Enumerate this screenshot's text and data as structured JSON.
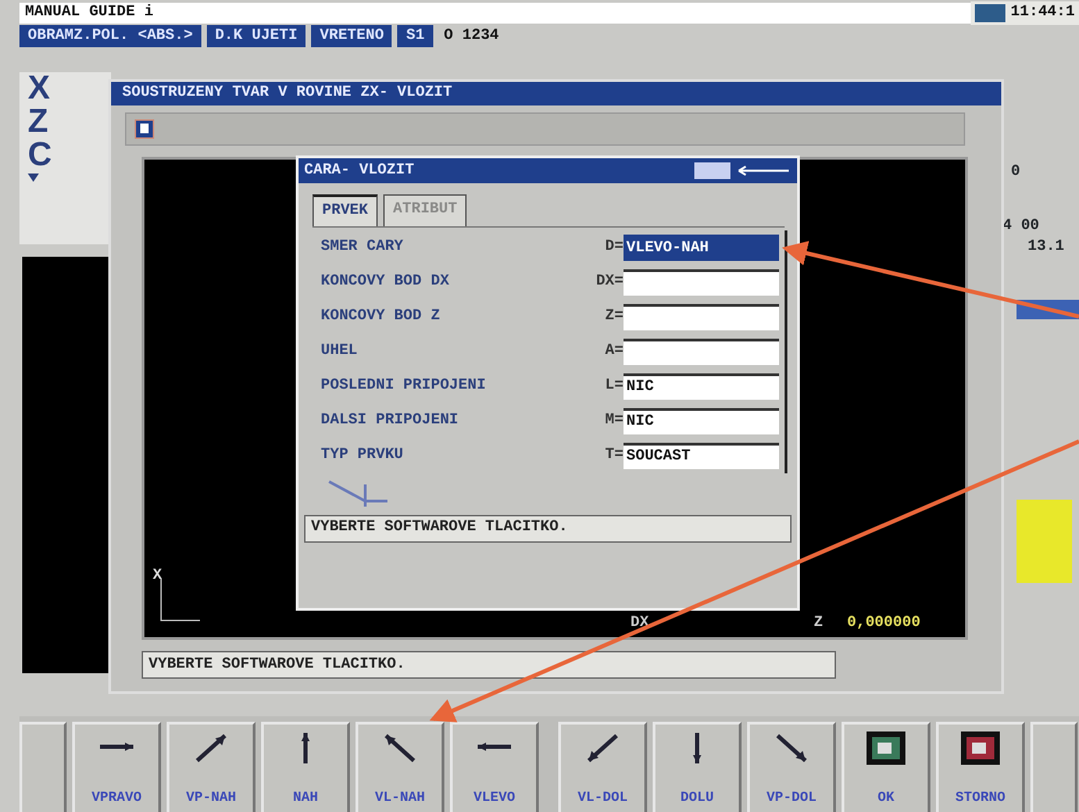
{
  "title_bar": {
    "title": "MANUAL GUIDE i",
    "clock": "11:44:1"
  },
  "status_row": {
    "segments": [
      "OBRAMZ.POL. <ABS.>",
      "D.K UJETI",
      "VRETENO",
      "S1"
    ],
    "program": "O 1234"
  },
  "axes": [
    "X",
    "Z",
    "C"
  ],
  "right_panel": {
    "texts": [
      "0",
      "4 00",
      "13.1"
    ]
  },
  "main_window": {
    "title": "SOUSTRUZENY TVAR V ROVINE ZX- VLOZIT",
    "canvas": {
      "axis_label": "X",
      "coord_label": "DX",
      "z_label": "Z",
      "z_value": "0,000000"
    },
    "message": "VYBERTE SOFTWAROVE TLACITKO."
  },
  "dialog": {
    "title": "CARA- VLOZIT",
    "tabs": [
      {
        "label": "PRVEK",
        "selected": true,
        "disabled": false
      },
      {
        "label": "ATRIBUT",
        "selected": false,
        "disabled": true
      }
    ],
    "fields": [
      {
        "label": "SMER CARY",
        "code": "D=",
        "value": "VLEVO-NAH",
        "kind": "choice"
      },
      {
        "label": "KONCOVY BOD DX",
        "code": "DX=",
        "kind": "input"
      },
      {
        "label": "KONCOVY BOD Z",
        "code": "Z=",
        "kind": "input"
      },
      {
        "label": "UHEL",
        "code": "A=",
        "kind": "input"
      },
      {
        "label": "POSLEDNI PRIPOJENI",
        "code": "L=",
        "value": "NIC",
        "kind": "input"
      },
      {
        "label": "DALSI PRIPOJENI",
        "code": "M=",
        "value": "NIC",
        "kind": "input"
      },
      {
        "label": "TYP PRVKU",
        "code": "T=",
        "value": "SOUCAST",
        "kind": "input"
      }
    ],
    "message": "VYBERTE SOFTWAROVE TLACITKO."
  },
  "softkeys": [
    {
      "label": "VPRAVO",
      "kind": "right"
    },
    {
      "label": "VP-NAH",
      "kind": "upright"
    },
    {
      "label": "NAH",
      "kind": "up"
    },
    {
      "label": "VL-NAH",
      "kind": "upleft"
    },
    {
      "label": "VLEVO",
      "kind": "left"
    },
    {
      "label": "VL-DOL",
      "kind": "downleft"
    },
    {
      "label": "DOLU",
      "kind": "down"
    },
    {
      "label": "VP-DOL",
      "kind": "downright"
    },
    {
      "label": "OK",
      "kind": "ok"
    },
    {
      "label": "STORNO",
      "kind": "cancel"
    }
  ]
}
